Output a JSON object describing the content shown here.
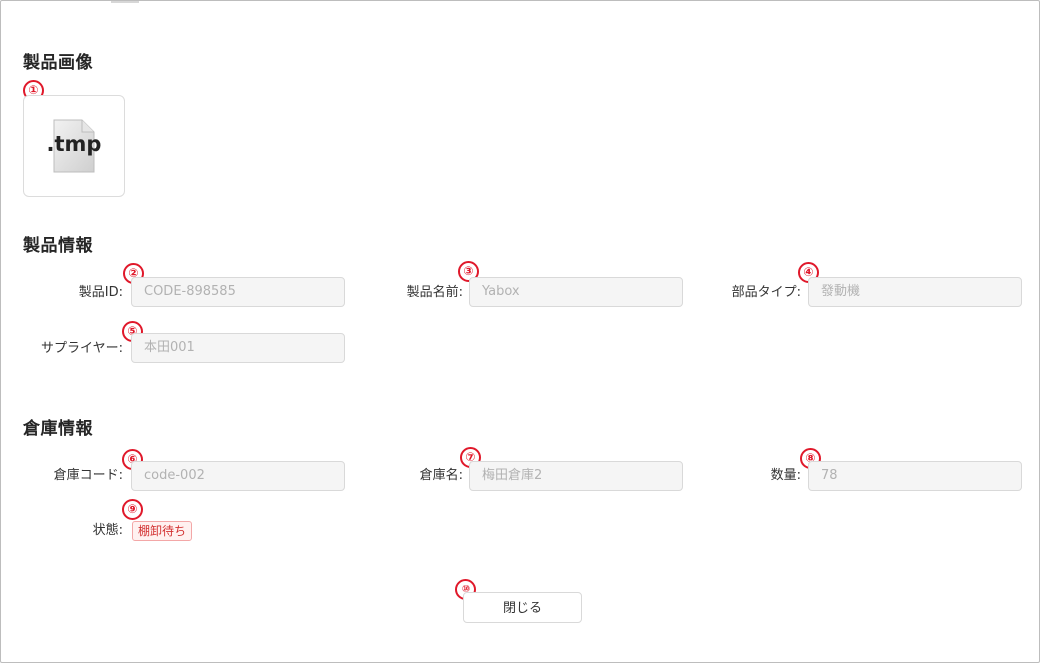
{
  "sections": {
    "image_title": "製品画像",
    "product_title": "製品情報",
    "warehouse_title": "倉庫情報"
  },
  "badges": [
    "①",
    "②",
    "③",
    "④",
    "⑤",
    "⑥",
    "⑦",
    "⑧",
    "⑨",
    "⑩"
  ],
  "image": {
    "file_ext": ".tmp",
    "icon": "file-icon"
  },
  "product": {
    "id_label": "製品ID:",
    "id_value": "CODE-898585",
    "name_label": "製品名前:",
    "name_value": "Yabox",
    "type_label": "部品タイプ:",
    "type_value": "發動機",
    "supplier_label": "サプライヤー:",
    "supplier_value": "本田001"
  },
  "warehouse": {
    "code_label": "倉庫コード:",
    "code_value": "code-002",
    "name_label": "倉庫名:",
    "name_value": "梅田倉庫2",
    "qty_label": "数量:",
    "qty_value": "78",
    "status_label": "状態:",
    "status_value": "棚卸待ち"
  },
  "footer": {
    "close_label": "閉じる"
  },
  "colors": {
    "badge": "#e0182a",
    "field_bg": "#f5f5f5",
    "status_bg": "#fff1f0",
    "status_text": "#d23030"
  }
}
